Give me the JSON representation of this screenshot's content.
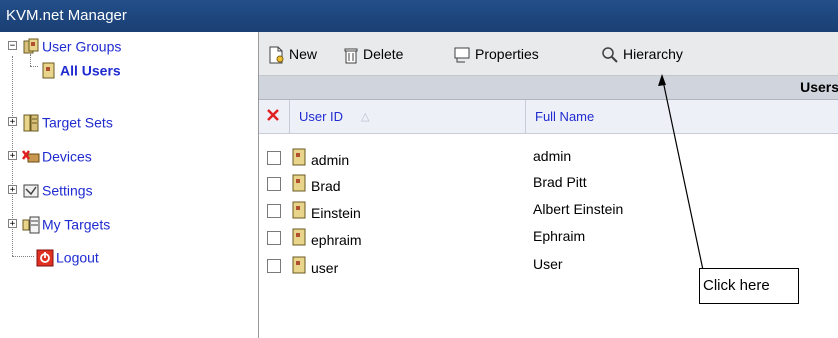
{
  "window": {
    "title": "KVM.net Manager"
  },
  "tree": {
    "items": [
      {
        "label": "User Groups",
        "icon": "user-groups-icon",
        "expander": "−"
      },
      {
        "label": "All Users",
        "icon": "user-icon"
      },
      {
        "label": "Target Sets",
        "icon": "target-sets-icon",
        "expander": "+"
      },
      {
        "label": "Devices",
        "icon": "devices-icon",
        "expander": "+"
      },
      {
        "label": "Settings",
        "icon": "settings-icon",
        "expander": "+"
      },
      {
        "label": "My Targets",
        "icon": "my-targets-icon",
        "expander": "+"
      },
      {
        "label": "Logout",
        "icon": "logout-icon"
      }
    ]
  },
  "toolbar": {
    "new_label": "New",
    "delete_label": "Delete",
    "properties_label": "Properties",
    "hierarchy_label": "Hierarchy"
  },
  "section": {
    "title": "Users"
  },
  "grid": {
    "columns": {
      "user_id": "User ID",
      "full_name": "Full Name"
    },
    "sort_indicator": "△",
    "rows": [
      {
        "user_id": "admin",
        "full_name": "admin"
      },
      {
        "user_id": "Brad",
        "full_name": "Brad Pitt"
      },
      {
        "user_id": "Einstein",
        "full_name": "Albert Einstein"
      },
      {
        "user_id": "ephraim",
        "full_name": "Ephraim"
      },
      {
        "user_id": "user",
        "full_name": "User"
      }
    ]
  },
  "annotation": {
    "callout_text": "Click here"
  },
  "colors": {
    "title_bar": "#1a3f73",
    "link_blue": "#1f2bd0",
    "toolbar_bg": "#e8eaec",
    "delete_red": "#e02020"
  }
}
